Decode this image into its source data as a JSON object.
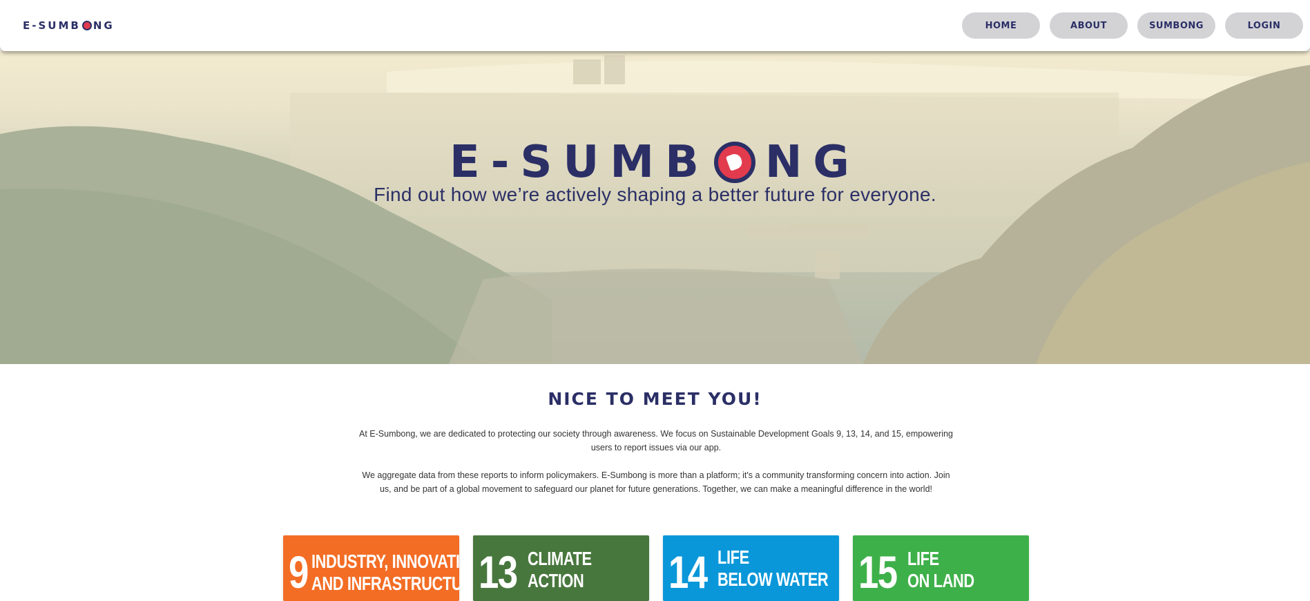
{
  "header": {
    "brand": "E-SUMB",
    "brand_tail": "NG",
    "nav": [
      {
        "label": "HOME"
      },
      {
        "label": "ABOUT"
      },
      {
        "label": "SUMBONG"
      },
      {
        "label": "LOGIN"
      }
    ]
  },
  "hero": {
    "logo_start": "E-SUMB",
    "logo_end": "NG",
    "tagline": "Find out how we’re actively shaping a better future for everyone."
  },
  "about": {
    "title": "NICE TO MEET YOU!",
    "paragraph1": "At E-Sumbong, we are dedicated to protecting our society through awareness. We focus on Sustainable Development Goals 9, 13, 14, and 15, empowering users to report issues via our app.",
    "paragraph2": "We aggregate data from these reports to inform policymakers. E-Sumbong is more than a platform; it's a community transforming concern into action. Join us, and be part of a global movement to safeguard our planet for future generations. Together, we can make a meaningful difference in the world!"
  },
  "sdg_cards": [
    {
      "number": "9",
      "line1": "INDUSTRY, INNOVATION",
      "line2": "AND INFRASTRUCTURE",
      "color": "#f36d25"
    },
    {
      "number": "13",
      "line1": "CLIMATE",
      "line2": "ACTION",
      "color": "#48773e"
    },
    {
      "number": "14",
      "line1": "LIFE",
      "line2": "BELOW WATER",
      "color": "#0a97d9"
    },
    {
      "number": "15",
      "line1": "LIFE",
      "line2": "ON LAND",
      "color": "#3eb049"
    }
  ],
  "colors": {
    "brand_navy": "#2b2f66",
    "brand_red": "#e23b4e",
    "nav_button_bg": "#d3d3d6"
  }
}
